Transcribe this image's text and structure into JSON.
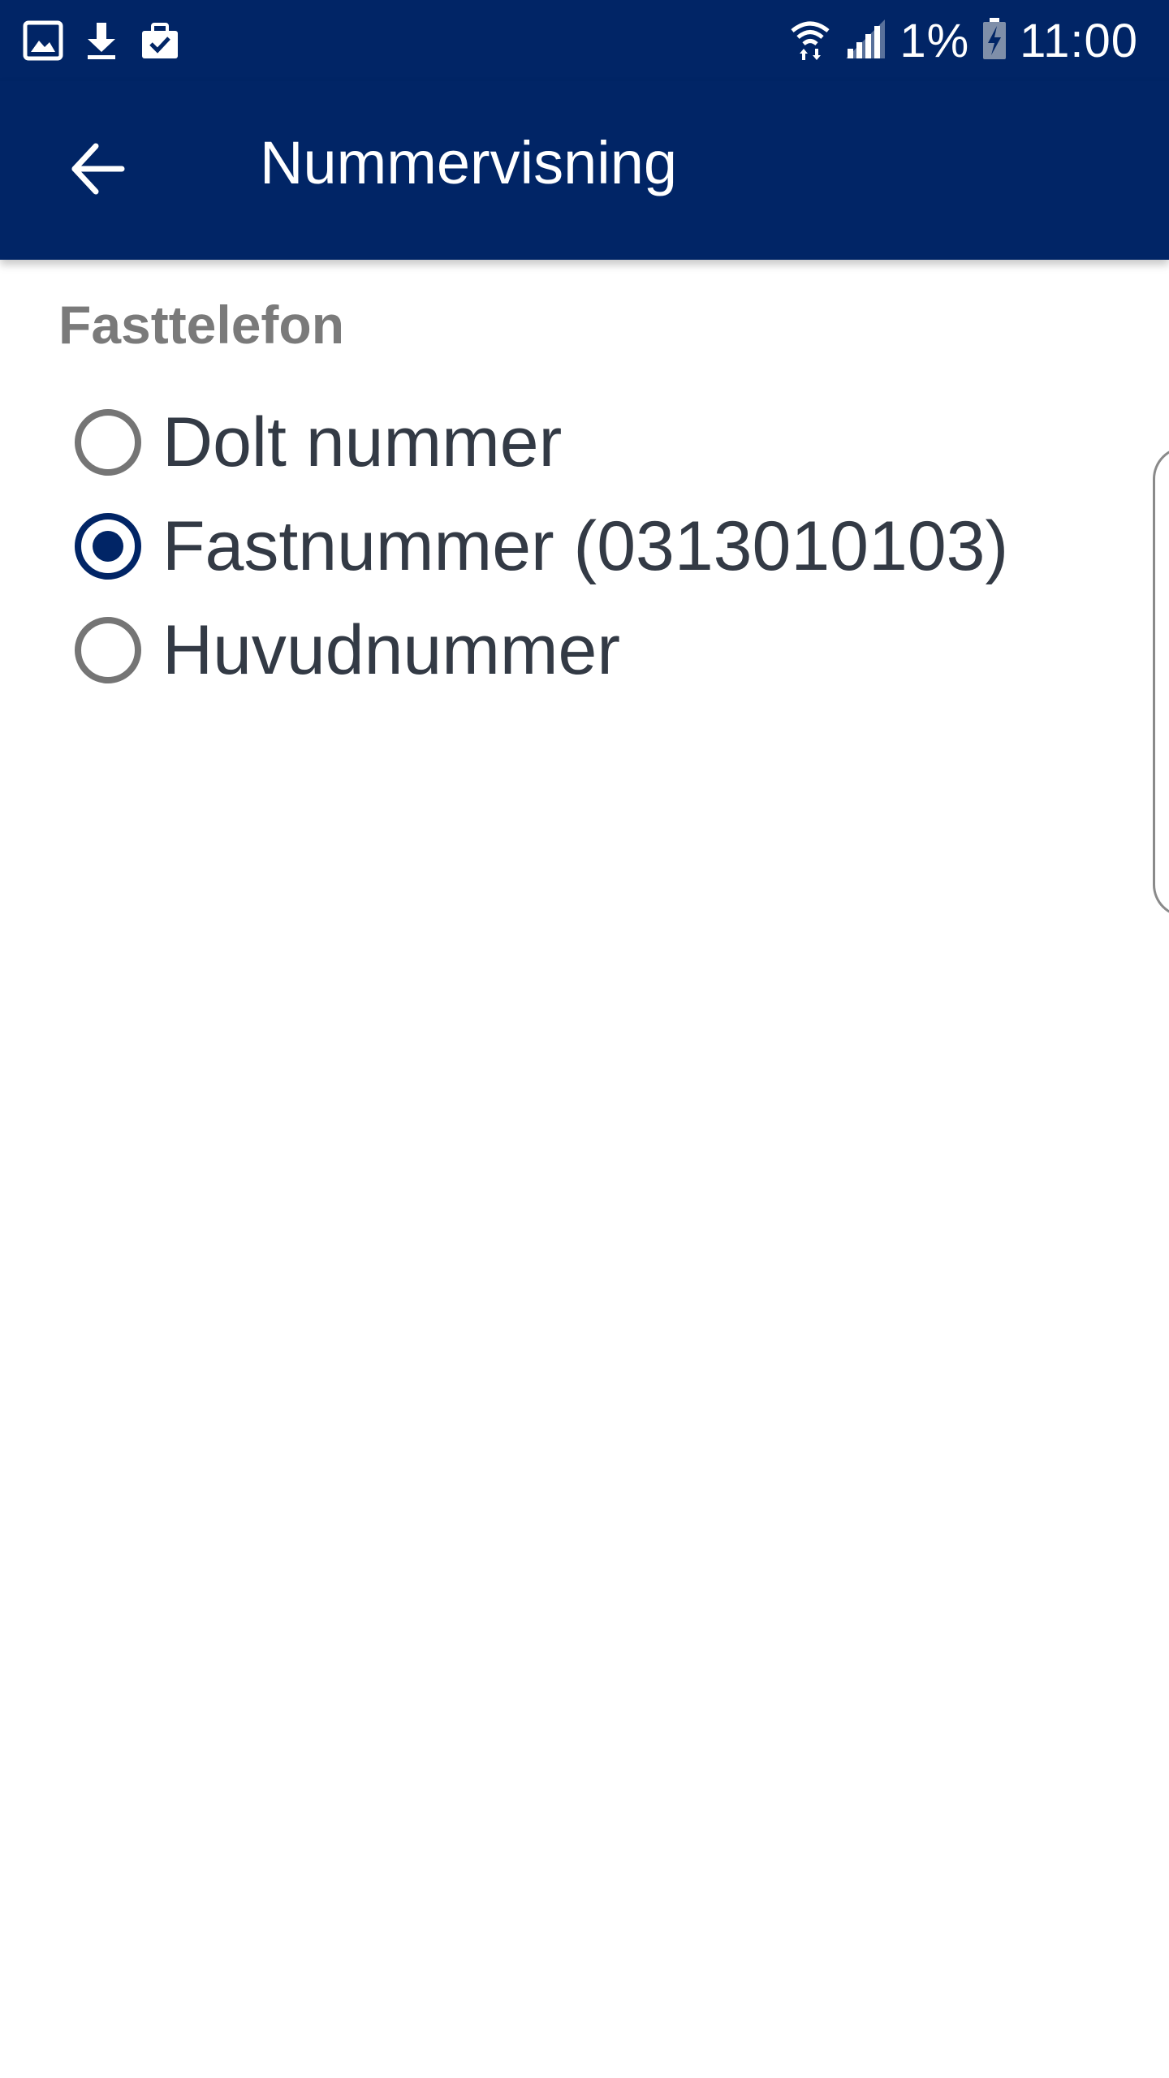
{
  "status_bar": {
    "left_icons": [
      "gallery-icon",
      "download-icon",
      "briefcase-check-icon"
    ],
    "right_icons": [
      "wifi-icon",
      "signal-icon",
      "battery-charging-icon"
    ],
    "battery_percent": "1%",
    "time": "11:00"
  },
  "app_bar": {
    "title": "Nummervisning",
    "back_icon": "arrow-back-icon"
  },
  "section": {
    "title": "Fasttelefon",
    "options": [
      {
        "label": "Dolt nummer",
        "selected": false
      },
      {
        "label": "Fastnummer (0313010103)",
        "selected": true
      },
      {
        "label": "Huvudnummer",
        "selected": false
      }
    ]
  },
  "colors": {
    "primary": "#012566",
    "radio_unselected": "#757575",
    "section_title": "#7a7a7a",
    "option_text": "#333a45"
  }
}
